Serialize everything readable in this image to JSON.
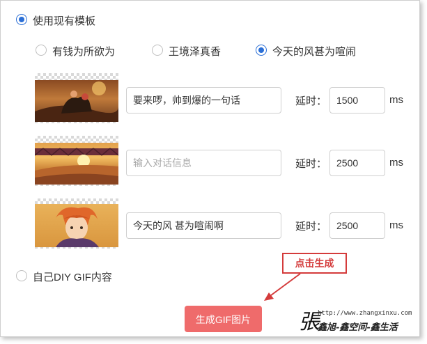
{
  "template_option": {
    "label": "使用现有模板",
    "checked": true
  },
  "templates": [
    {
      "label": "有钱为所欲为",
      "checked": false
    },
    {
      "label": "王境泽真香",
      "checked": false
    },
    {
      "label": "今天的风甚为喧闹",
      "checked": true
    }
  ],
  "frames": [
    {
      "text": "要来啰，帅到爆的一句话",
      "placeholder": "",
      "delay_label": "延时：",
      "delay": "1500",
      "unit": "ms",
      "thumb_icon": "anime-frame-riders"
    },
    {
      "text": "",
      "placeholder": "输入对话信息",
      "delay_label": "延时：",
      "delay": "2500",
      "unit": "ms",
      "thumb_icon": "anime-frame-sunset-bridge"
    },
    {
      "text": "今天的风 甚为喧闹啊",
      "placeholder": "",
      "delay_label": "延时：",
      "delay": "2500",
      "unit": "ms",
      "thumb_icon": "anime-frame-character"
    }
  ],
  "diy_option": {
    "label": "自己DIY GIF内容",
    "checked": false
  },
  "generate_button": "生成GIF图片",
  "annotation": {
    "callout": "点击生成"
  },
  "watermark": {
    "url": "http://www.zhangxinxu.com",
    "name": "鑫旭-鑫空间-鑫生活",
    "glyph": "張"
  },
  "colors": {
    "accent": "#2b6fd6",
    "button": "#ef6b6b",
    "callout": "#d43b3b"
  }
}
